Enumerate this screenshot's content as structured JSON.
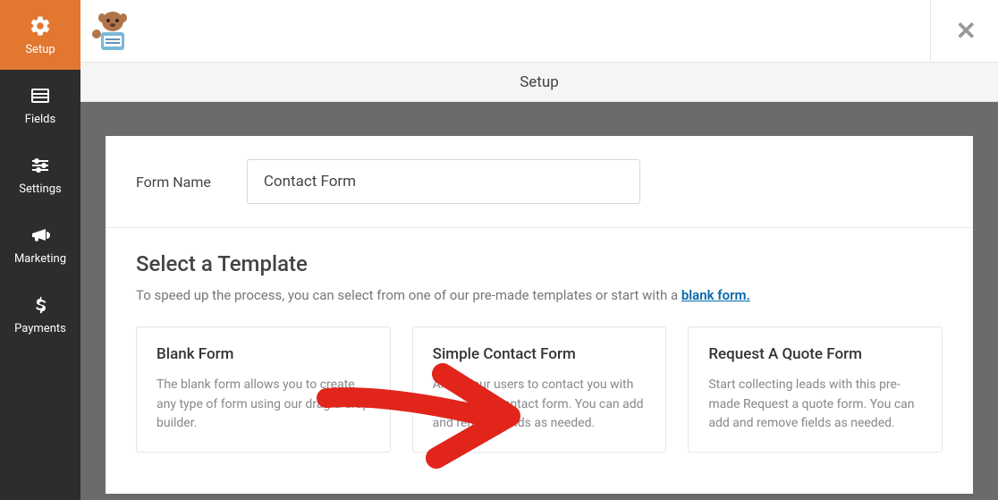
{
  "header": {
    "title": "Setup"
  },
  "sidebar": {
    "items": [
      {
        "label": "Setup"
      },
      {
        "label": "Fields"
      },
      {
        "label": "Settings"
      },
      {
        "label": "Marketing"
      },
      {
        "label": "Payments"
      }
    ]
  },
  "form_name": {
    "label": "Form Name",
    "value": "Contact Form"
  },
  "template_section": {
    "title": "Select a Template",
    "desc_prefix": "To speed up the process, you can select from one of our pre-made templates or start with a ",
    "desc_link": "blank form."
  },
  "templates": [
    {
      "title": "Blank Form",
      "desc": "The blank form allows you to create any type of form using our drag & drop builder."
    },
    {
      "title": "Simple Contact Form",
      "desc": "Allow your users to contact you with this simple contact form. You can add and remove fields as needed."
    },
    {
      "title": "Request A Quote Form",
      "desc": "Start collecting leads with this pre-made Request a quote form. You can add and remove fields as needed."
    }
  ]
}
